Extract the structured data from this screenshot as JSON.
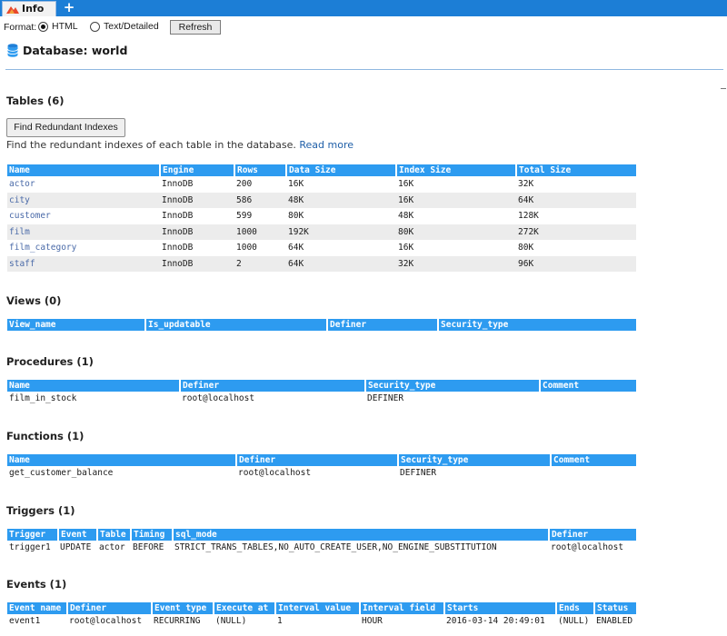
{
  "tabs": {
    "active_label": "Info",
    "add_label": "+"
  },
  "format": {
    "label": "Format:",
    "options": [
      {
        "label": "HTML",
        "selected": true
      },
      {
        "label": "Text/Detailed",
        "selected": false
      }
    ],
    "refresh_label": "Refresh"
  },
  "database": {
    "title": "Database: world"
  },
  "tables_section": {
    "title": "Tables (6)",
    "button_label": "Find Redundant Indexes",
    "description": "Find the redundant indexes of each table in the database.",
    "read_more": "Read more",
    "headers": [
      "Name",
      "Engine",
      "Rows",
      "Data Size",
      "Index Size",
      "Total Size"
    ],
    "rows": [
      [
        "actor",
        "InnoDB",
        "200",
        "16K",
        "16K",
        "32K"
      ],
      [
        "city",
        "InnoDB",
        "586",
        "48K",
        "16K",
        "64K"
      ],
      [
        "customer",
        "InnoDB",
        "599",
        "80K",
        "48K",
        "128K"
      ],
      [
        "film",
        "InnoDB",
        "1000",
        "192K",
        "80K",
        "272K"
      ],
      [
        "film_category",
        "InnoDB",
        "1000",
        "64K",
        "16K",
        "80K"
      ],
      [
        "staff",
        "InnoDB",
        "2",
        "64K",
        "32K",
        "96K"
      ]
    ]
  },
  "views_section": {
    "title": "Views (0)",
    "headers": [
      "View_name",
      "Is_updatable",
      "Definer",
      "Security_type"
    ],
    "rows": []
  },
  "procedures_section": {
    "title": "Procedures (1)",
    "headers": [
      "Name",
      "Definer",
      "Security_type",
      "Comment"
    ],
    "rows": [
      [
        "film_in_stock",
        "root@localhost",
        "DEFINER",
        ""
      ]
    ]
  },
  "functions_section": {
    "title": "Functions (1)",
    "headers": [
      "Name",
      "Definer",
      "Security_type",
      "Comment"
    ],
    "rows": [
      [
        "get_customer_balance",
        "root@localhost",
        "DEFINER",
        ""
      ]
    ]
  },
  "triggers_section": {
    "title": "Triggers (1)",
    "headers": [
      "Trigger",
      "Event",
      "Table",
      "Timing",
      "sql_mode",
      "Definer"
    ],
    "rows": [
      [
        "trigger1",
        "UPDATE",
        "actor",
        "BEFORE",
        "STRICT_TRANS_TABLES,NO_AUTO_CREATE_USER,NO_ENGINE_SUBSTITUTION",
        "root@localhost"
      ]
    ]
  },
  "events_section": {
    "title": "Events (1)",
    "headers": [
      "Event name",
      "Definer",
      "Event type",
      "Execute at",
      "Interval value",
      "Interval field",
      "Starts",
      "Ends",
      "Status"
    ],
    "rows": [
      [
        "event1",
        "root@localhost",
        "RECURRING",
        "(NULL)",
        "1",
        "HOUR",
        "2016-03-14 20:49:01",
        "(NULL)",
        "ENABLED"
      ]
    ]
  },
  "colors": {
    "header_blue": "#2d9bf0",
    "tabbar_blue": "#1c7ed6",
    "link": "#1f5fa8"
  }
}
